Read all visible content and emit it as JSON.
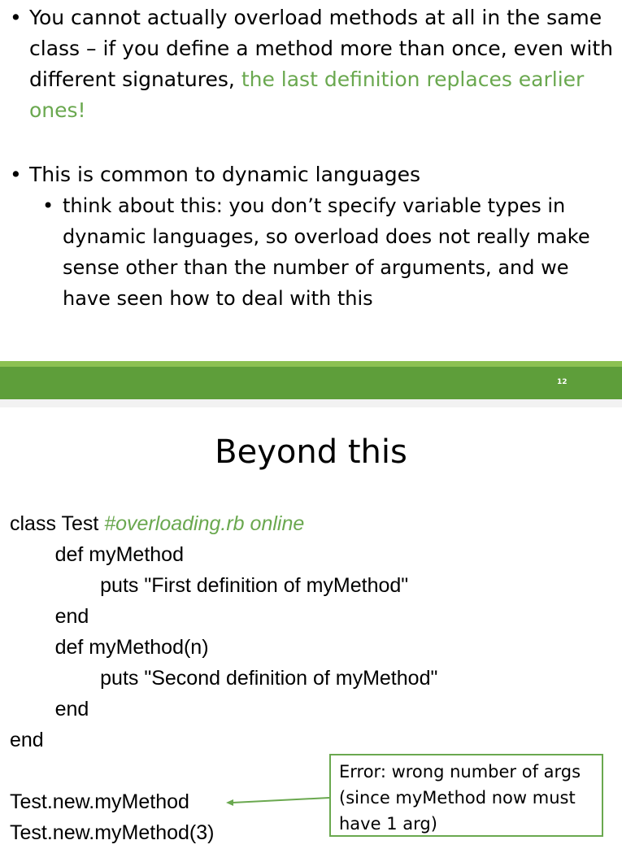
{
  "slide_top": {
    "bullet1_part1": "You cannot actually overload methods at all in the same class – if you define a method more than once, even with different signatures,",
    "bullet1_part2": "the last definition replaces earlier ones!",
    "bullet2": "This is common to dynamic languages",
    "bullet3": "think about this: you don’t specify variable types in dynamic languages, so overload does not really make sense other than the number of arguments, and we have seen how to deal with this",
    "page_number": "12"
  },
  "slide_bottom": {
    "title": "Beyond this",
    "code": [
      {
        "text": "class Test ",
        "comment": "#overloading.rb online"
      },
      {
        "text": "        def myMethod"
      },
      {
        "text": "                puts \"First definition of myMethod\""
      },
      {
        "text": "        end"
      },
      {
        "text": "        def myMethod(n)"
      },
      {
        "text": "                puts \"Second definition of myMethod\""
      },
      {
        "text": "        end"
      },
      {
        "text": "end"
      },
      {
        "text": ""
      },
      {
        "text": "Test.new.myMethod"
      },
      {
        "text": "Test.new.myMethod(3)"
      }
    ],
    "callout": "Error: wrong number of args (since myMethod now must have 1 arg)"
  },
  "colors": {
    "accent_green": "#6aa84f",
    "footer_dark": "#5e9e3a",
    "footer_light": "#8cc152"
  }
}
